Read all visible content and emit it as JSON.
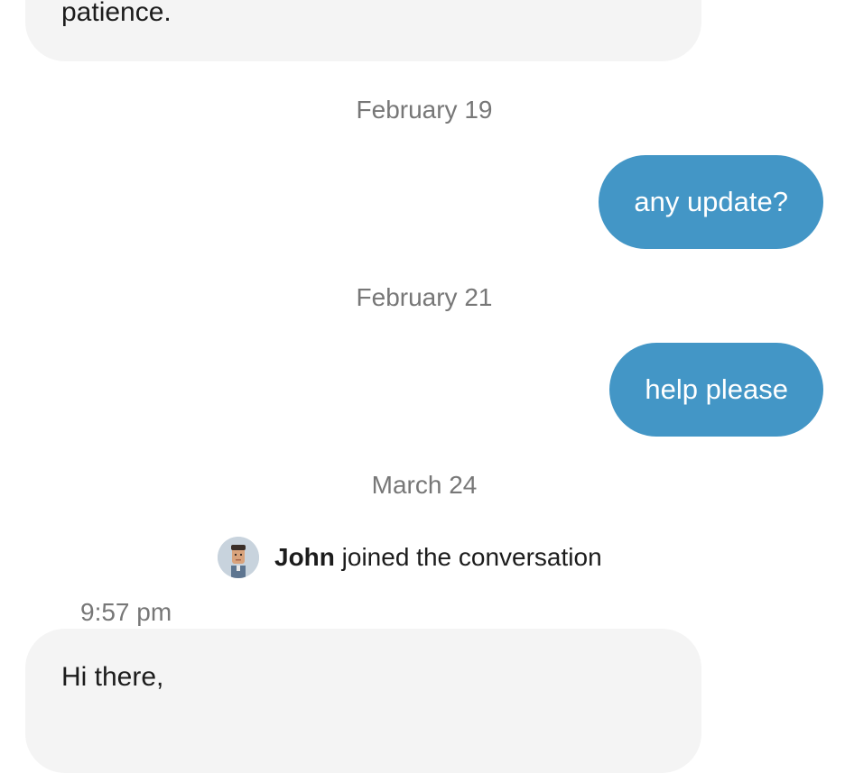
{
  "messages": {
    "prev_incoming_tail": "patience.",
    "date_1": "February 19",
    "outgoing_1": "any update?",
    "date_2": "February 21",
    "outgoing_2": "help please",
    "date_3": "March 24",
    "join": {
      "name": "John",
      "action": " joined the conversation",
      "avatar_icon": "agent-avatar-icon"
    },
    "timestamp": "9:57 pm",
    "incoming_latest": "Hi there,"
  },
  "colors": {
    "outgoing_bubble": "#4396c6",
    "incoming_bubble": "#f4f4f4",
    "meta_text": "#777777",
    "body_text": "#1c1c1c"
  }
}
